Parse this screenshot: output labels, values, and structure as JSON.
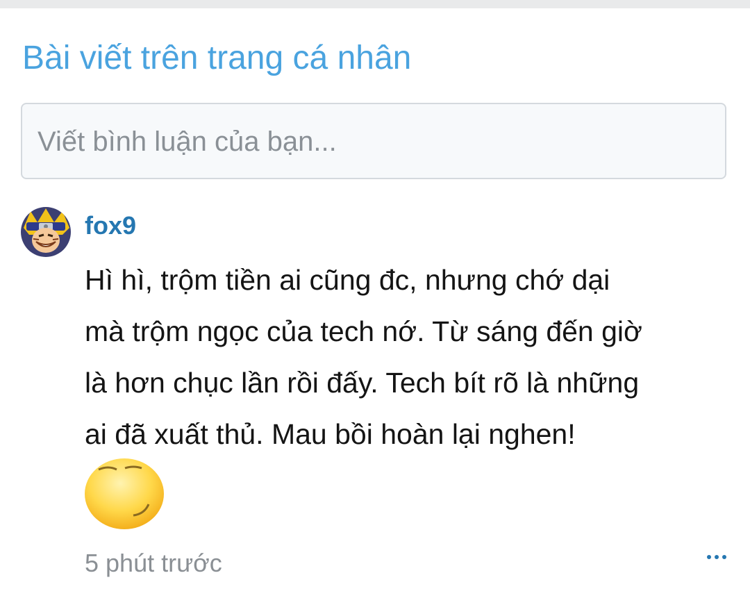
{
  "section": {
    "title": "Bài viết trên trang cá nhân"
  },
  "comment_box": {
    "placeholder": "Viết bình luận của bạn..."
  },
  "post": {
    "author": "fox9",
    "message_lines": [
      "Hì hì, trộm tiền ai cũng đc, nhưng chớ dại",
      "mà trộm ngọc của tech nớ. Từ sáng đến giờ",
      "là hơn chục lần rồi đấy. Tech bít rõ là những",
      "ai đã xuất thủ. Mau bồi hoàn lại nghen!"
    ],
    "emoticon": "smug-smiley-emoticon",
    "timestamp": "5 phút trước"
  },
  "icons": {
    "avatar": "ninja-avatar",
    "more": "more-options-icon"
  },
  "colors": {
    "accent": "#4aa3df",
    "username": "#2577b1",
    "text": "#141414",
    "muted": "#8a8f94"
  }
}
